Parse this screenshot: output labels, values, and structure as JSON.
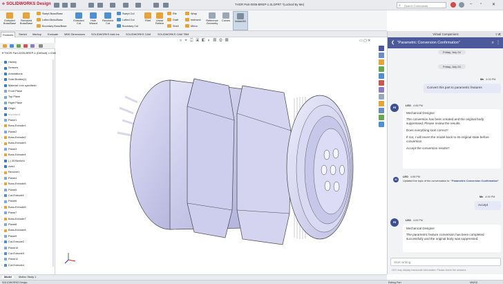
{
  "titlebar": {
    "brand": "SOLIDWORKS Design",
    "doc_title": "THOR Part-0005-BREP-1.SLDPRT *(Locked By Me)",
    "search_placeholder": "Search Commands"
  },
  "command_manager": {
    "features_large": [
      {
        "label1": "Extruded",
        "label2": "Boss/Base"
      },
      {
        "label1": "Revolved",
        "label2": "Boss/Base"
      }
    ],
    "features_small": [
      "Swept Boss/Base",
      "Lofted Boss/Base",
      "Boundary Boss/Base"
    ],
    "cuts_large": [
      {
        "label1": "Extruded",
        "label2": "Cut"
      },
      {
        "label1": "Hole",
        "label2": "Wizard"
      },
      {
        "label1": "Revolved",
        "label2": "Cut"
      }
    ],
    "cuts_small": [
      "Swept Cut",
      "Lofted Cut",
      "Boundary Cut"
    ],
    "fillet": "Fillet",
    "pattern": {
      "label1": "Linear",
      "label2": "Pattern"
    },
    "col3": [
      "Rib",
      "Draft",
      "Shell"
    ],
    "col4": [
      "Wrap",
      "Intersect",
      "Mirror"
    ],
    "reference_geometry": {
      "label1": "Reference",
      "label2": "Geometry"
    },
    "curves": "Curves",
    "instant3d": "Instant3D"
  },
  "cm_tabs": [
    "Features",
    "Sketch",
    "Markup",
    "Evaluate",
    "MBD Dimensions",
    "SOLIDWORKS Add-Ins",
    "SOLIDWORKS CAM",
    "SOLIDWORKS CAM TBM"
  ],
  "feature_manager": {
    "root": "THOR Part-0005-BREP-1 (Default) <<Default>_D...",
    "items": [
      {
        "label": "History",
        "icon": "history-icon"
      },
      {
        "label": "Sensors",
        "icon": "sensor-icon"
      },
      {
        "label": "Annotations",
        "icon": "annotation-icon"
      },
      {
        "label": "Solid Bodies(1)",
        "icon": "solid-bodies-icon"
      },
      {
        "label": "Material <not specified>",
        "icon": "material-icon"
      },
      {
        "label": "Front Plane",
        "icon": "plane-icon"
      },
      {
        "label": "Top Plane",
        "icon": "plane-icon"
      },
      {
        "label": "Right Plane",
        "icon": "plane-icon"
      },
      {
        "label": "Origin",
        "icon": "origin-icon"
      },
      {
        "label": "Imported1",
        "icon": "imported-icon"
      },
      {
        "label": "Plane1",
        "icon": "plane-icon"
      },
      {
        "label": "Boss-Extrude1",
        "icon": "extrude-icon"
      },
      {
        "label": "Plane2",
        "icon": "plane-icon"
      },
      {
        "label": "Boss-Extrude2",
        "icon": "extrude-icon"
      },
      {
        "label": "Boss-Extrude3",
        "icon": "extrude-icon"
      },
      {
        "label": "Plane3",
        "icon": "plane-icon"
      },
      {
        "label": "Boss-Extrude4",
        "icon": "extrude-icon"
      },
      {
        "label": "(-) 3DSketch1",
        "icon": "sketch-icon"
      },
      {
        "label": "Axis1",
        "icon": "axis-icon"
      },
      {
        "label": "Revolve1",
        "icon": "revolve-icon"
      },
      {
        "label": "Plane4",
        "icon": "plane-icon"
      },
      {
        "label": "Boss-Extrude5",
        "icon": "extrude-icon"
      },
      {
        "label": "Plane5",
        "icon": "plane-icon"
      },
      {
        "label": "Cut-Extrude1",
        "icon": "cut-icon"
      },
      {
        "label": "Plane6",
        "icon": "plane-icon"
      },
      {
        "label": "Boss-Extrude6",
        "icon": "extrude-icon"
      },
      {
        "label": "Plane7",
        "icon": "plane-icon"
      },
      {
        "label": "Boss-Extrude7",
        "icon": "extrude-icon"
      },
      {
        "label": "Plane8",
        "icon": "plane-icon"
      },
      {
        "label": "Boss-Extrude8",
        "icon": "extrude-icon"
      },
      {
        "label": "Plane9",
        "icon": "plane-icon"
      },
      {
        "label": "Cut-Extrude2",
        "icon": "cut-icon"
      },
      {
        "label": "Plane10",
        "icon": "plane-icon"
      },
      {
        "label": "Cut-Extrude3",
        "icon": "cut-icon"
      },
      {
        "label": "Plane11",
        "icon": "plane-icon"
      },
      {
        "label": "Cut-Extrude4",
        "icon": "cut-icon"
      }
    ]
  },
  "chat": {
    "panel_title": "Virtual Companions",
    "thread_title": "\"Parametric Conversion Confirmation\"",
    "date1": "Friday, July 24",
    "date2": "Friday, July 24",
    "me_name1": "Me",
    "me_time1": "4:03 PM",
    "me_msg1": "Convert this part to parametric features",
    "leo_name1": "LEO",
    "leo_time1": "4:08 PM",
    "leo_role1": "Mechanical Designer",
    "leo_p1": "The conversion has been created and the original body suppressed. Please review the results.",
    "leo_p2": "Does everything look correct?",
    "leo_p3": "If not, I will revert the model back to its original state before conversion.",
    "leo_p4": "Accept the conversion results?",
    "sys_name": "LEO",
    "sys_time": "4:08 PM",
    "sys_text": "Updated the topic of the conversation to:",
    "sys_topic": "\"Parametric Conversion Confirmation\"",
    "me_name2": "Me",
    "me_time2": "4:09 PM",
    "me_msg2": "Accept",
    "leo_name2": "LEO",
    "leo_time2": "4:09 PM",
    "leo_role2": "Mechanical Designer",
    "leo_msg2": "The parametric feature conversion has been completed successfully and the original body was suppressed.",
    "input_placeholder": "Start writing",
    "disclaimer": "LEO may display inaccurate information. Please check the answers.",
    "avatar_text": "AI"
  },
  "model_tabs": [
    "Model",
    "Motion Study 1"
  ],
  "status": {
    "left": "SOLIDWORKS Design",
    "mode": "Editing Part",
    "units": "MMGS"
  },
  "colors": {
    "chat_header": "#4c5a9c",
    "part_fill": "#c9c9ee",
    "brand_red": "#c8102e"
  }
}
